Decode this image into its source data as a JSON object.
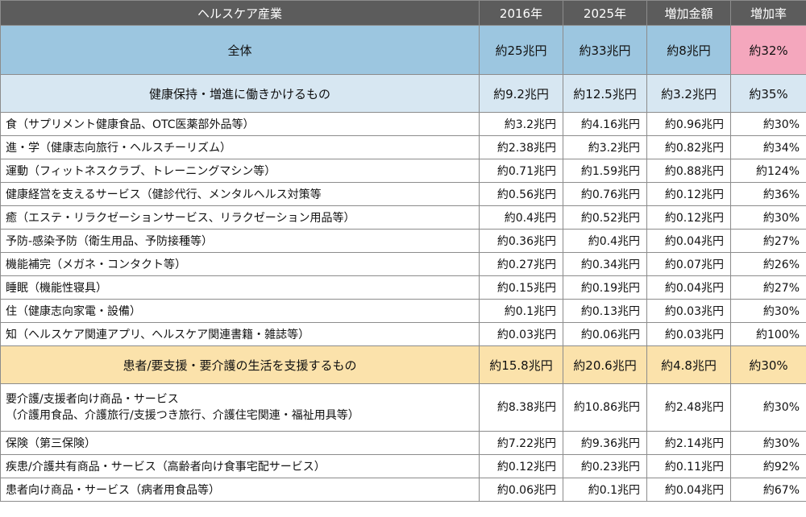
{
  "header": {
    "industry": "ヘルスケア産業",
    "y2016": "2016年",
    "y2025": "2025年",
    "increase": "増加金額",
    "rate": "増加率"
  },
  "total": {
    "label": "全体",
    "y2016": "約25兆円",
    "y2025": "約33兆円",
    "increase": "約8兆円",
    "rate": "約32%"
  },
  "section_a": {
    "label": "健康保持・増進に働きかけるもの",
    "y2016": "約9.2兆円",
    "y2025": "約12.5兆円",
    "increase": "約3.2兆円",
    "rate": "約35%",
    "items": [
      {
        "label": "食（サプリメント健康食品、OTC医薬部外品等）",
        "y2016": "約3.2兆円",
        "y2025": "約4.16兆円",
        "increase": "約0.96兆円",
        "rate": "約30%"
      },
      {
        "label": "進・学（健康志向旅行・ヘルスチーリズム）",
        "y2016": "約2.38兆円",
        "y2025": "約3.2兆円",
        "increase": "約0.82兆円",
        "rate": "約34%"
      },
      {
        "label": "運動（フィットネスクラブ、トレーニングマシン等）",
        "y2016": "約0.71兆円",
        "y2025": "約1.59兆円",
        "increase": "約0.88兆円",
        "rate": "約124%"
      },
      {
        "label": "健康経営を支えるサービス（健診代行、メンタルヘルス対策等",
        "y2016": "約0.56兆円",
        "y2025": "約0.76兆円",
        "increase": "約0.12兆円",
        "rate": "約36%"
      },
      {
        "label": "癒（エステ・リラクゼーションサービス、リラクゼーション用品等）",
        "y2016": "約0.4兆円",
        "y2025": "約0.52兆円",
        "increase": "約0.12兆円",
        "rate": "約30%"
      },
      {
        "label": "予防-感染予防（衛生用品、予防接種等）",
        "y2016": "約0.36兆円",
        "y2025": "約0.4兆円",
        "increase": "約0.04兆円",
        "rate": "約27%"
      },
      {
        "label": "機能補完（メガネ・コンタクト等）",
        "y2016": "約0.27兆円",
        "y2025": "約0.34兆円",
        "increase": "約0.07兆円",
        "rate": "約26%"
      },
      {
        "label": "睡眠（機能性寝具）",
        "y2016": "約0.15兆円",
        "y2025": "約0.19兆円",
        "increase": "約0.04兆円",
        "rate": "約27%"
      },
      {
        "label": "住（健康志向家電・設備）",
        "y2016": "約0.1兆円",
        "y2025": "約0.13兆円",
        "increase": "約0.03兆円",
        "rate": "約30%"
      },
      {
        "label": "知（ヘルスケア関連アプリ、ヘルスケア関連書籍・雑誌等）",
        "y2016": "約0.03兆円",
        "y2025": "約0.06兆円",
        "increase": "約0.03兆円",
        "rate": "約100%"
      }
    ]
  },
  "section_b": {
    "label": "患者/要支援・要介護の生活を支援するもの",
    "y2016": "約15.8兆円",
    "y2025": "約20.6兆円",
    "increase": "約4.8兆円",
    "rate": "約30%",
    "tall_item": {
      "label_line1": "要介護/支援者向け商品・サービス",
      "label_line2": "（介護用食品、介護旅行/支援つき旅行、介護住宅関連・福祉用具等）",
      "y2016": "約8.38兆円",
      "y2025": "約10.86兆円",
      "increase": "約2.48兆円",
      "rate": "約30%"
    },
    "items": [
      {
        "label": "保険（第三保険）",
        "y2016": "約7.22兆円",
        "y2025": "約9.36兆円",
        "increase": "約2.14兆円",
        "rate": "約30%"
      },
      {
        "label": "疾患/介護共有商品・サービス（高齢者向け食事宅配サービス）",
        "y2016": "約0.12兆円",
        "y2025": "約0.23兆円",
        "increase": "約0.11兆円",
        "rate": "約92%"
      },
      {
        "label": "患者向け商品・サービス（病者用食品等）",
        "y2016": "約0.06兆円",
        "y2025": "約0.1兆円",
        "increase": "約0.04兆円",
        "rate": "約67%"
      }
    ]
  }
}
